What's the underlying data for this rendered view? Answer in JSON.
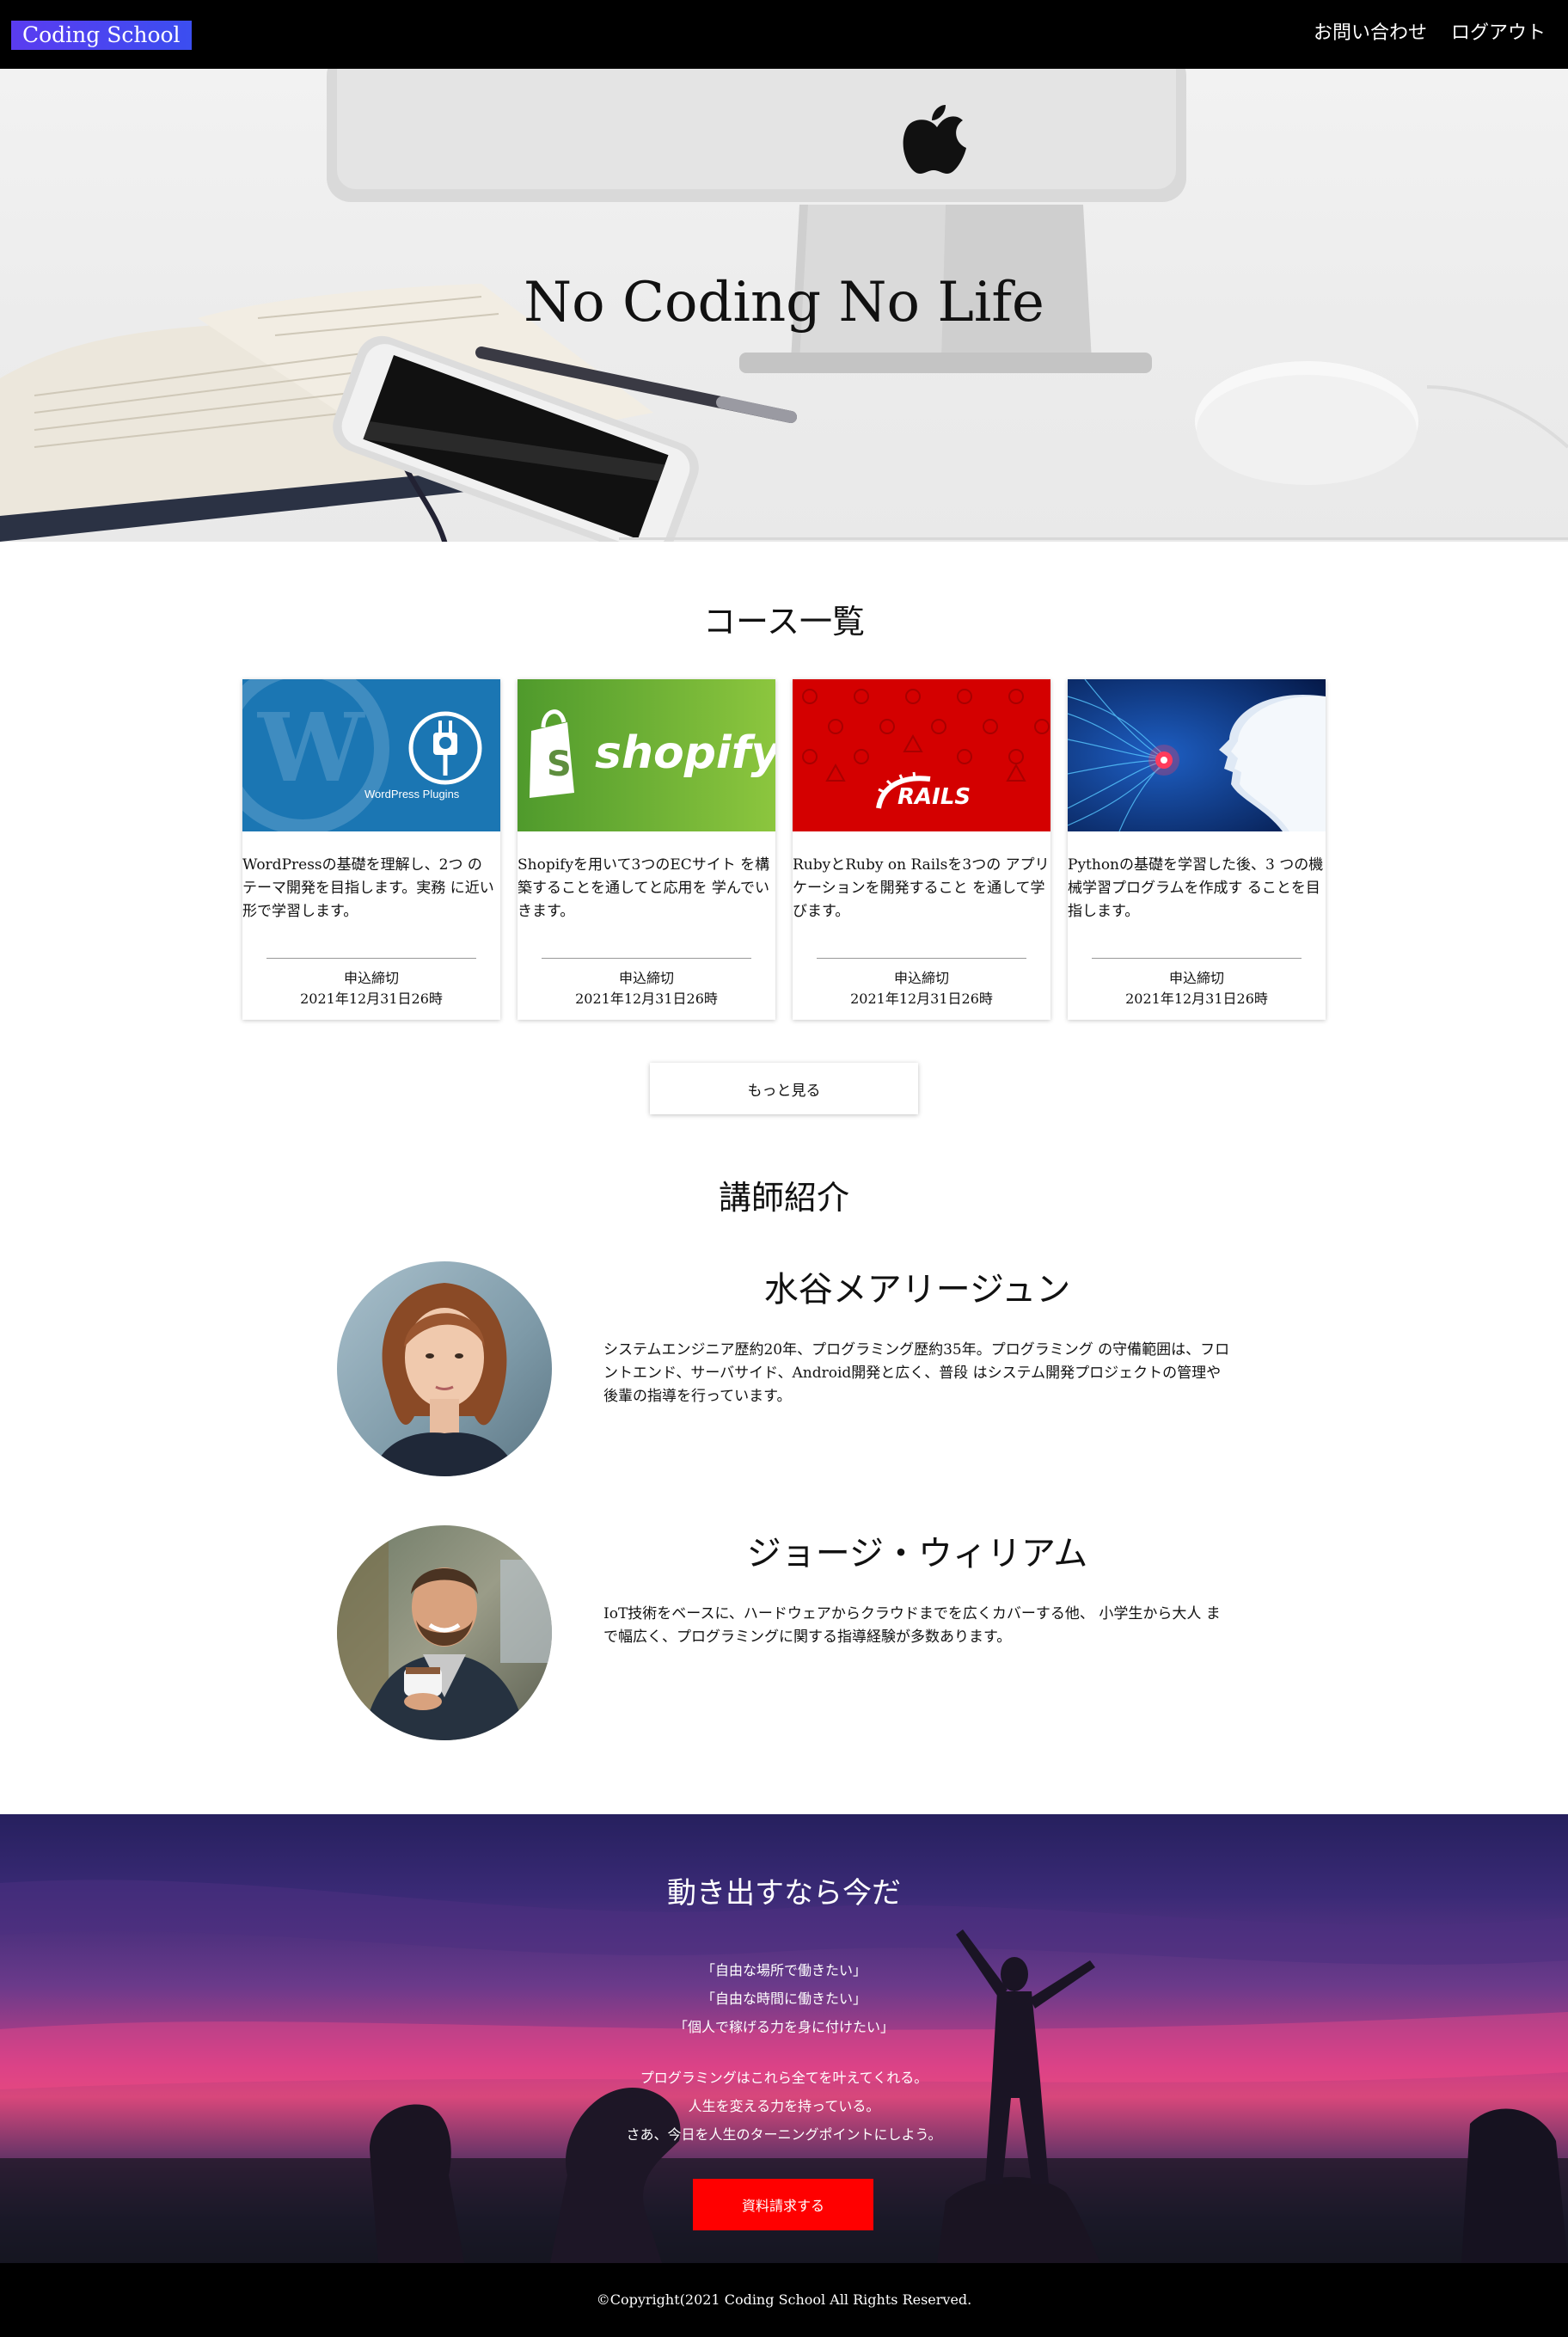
{
  "header": {
    "logo": "Coding School",
    "nav": [
      "お問い合わせ",
      "ログアウト"
    ]
  },
  "hero": {
    "title": "No Coding No Life"
  },
  "courses": {
    "title": "コース一覧",
    "items": [
      {
        "image_text": "WordPress Plugins",
        "description": "WordPressの基礎を理解し、2つ の テーマ開発を目指します。実務 に近い形で学習します。",
        "deadline_label": "申込締切",
        "deadline": "2021年12月31日26時"
      },
      {
        "image_text": "shopify",
        "description": "Shopifyを用いて3つのECサイト を構築することを通してと応用を 学んでいきます。",
        "deadline_label": "申込締切",
        "deadline": "2021年12月31日26時"
      },
      {
        "image_text": "RAILS",
        "description": "RubyとRuby on Railsを3つの アプリケーションを開発すること を通して学びます。",
        "deadline_label": "申込締切",
        "deadline": "2021年12月31日26時"
      },
      {
        "image_text": "",
        "description": "Pythonの基礎を学習した後、3 つの機械学習プログラムを作成す ることを目指します。",
        "deadline_label": "申込締切",
        "deadline": "2021年12月31日26時"
      }
    ],
    "more_label": "もっと見る"
  },
  "teachers": {
    "title": "講師紹介",
    "items": [
      {
        "name": "水谷メアリージュン",
        "bio": "システムエンジニア歴約20年、プログラミング歴約35年。プログラミング の守備範囲は、フロントエンド、サーバサイド、Android開発と広く、普段 はシステム開発プロジェクトの管理や後輩の指導を行っています。"
      },
      {
        "name": "ジョージ・ウィリアム",
        "bio": "IoT技術をベースに、ハードウェアからクラウドまでを広くカバーする他、 小学生から大人 まで幅広く、プログラミングに関する指導経験が多数あります。"
      }
    ]
  },
  "cta": {
    "title": "動き出すなら今だ",
    "quotes": [
      "「自由な場所で働きたい」",
      "「自由な時間に働きたい」",
      "「個人で稼げる力を身に付けたい」"
    ],
    "message": [
      "プログラミングはこれら全てを叶えてくれる。",
      "人生を変える力を持っている。",
      "さあ、今日を人生のターニングポイントにしよう。"
    ],
    "button_label": "資料請求する"
  },
  "footer": {
    "copyright": "©Copyright(2021 Coding School All Rights Reserved."
  },
  "colors": {
    "header_bg": "#000000",
    "logo_gradient": "#5a3cf0",
    "cta_button": "#ff0000",
    "wordpress_blue": "#1b76b3",
    "shopify_green": "#5ea731",
    "rails_red": "#d40000",
    "ai_navy": "#0a2a6a"
  }
}
